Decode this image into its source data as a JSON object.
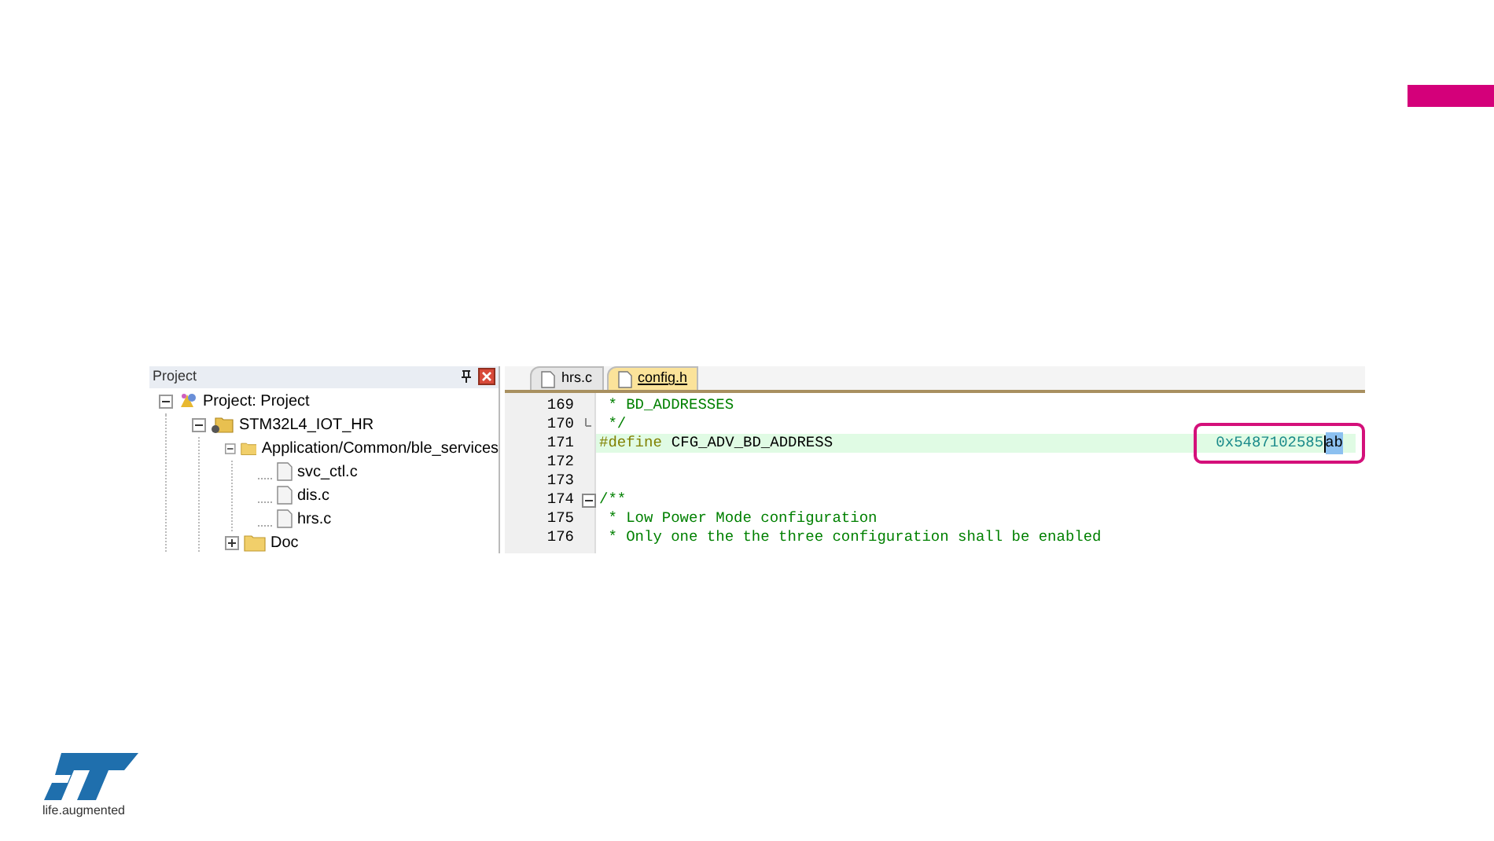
{
  "project_panel": {
    "title": "Project",
    "tree": [
      {
        "label": "Project: Project",
        "kind": "project",
        "expanded": true,
        "children": [
          {
            "label": "STM32L4_IOT_HR",
            "kind": "target",
            "expanded": true,
            "children": [
              {
                "label": "Application/Common/ble_services",
                "kind": "folder",
                "expanded": true,
                "children": [
                  {
                    "label": "svc_ctl.c",
                    "kind": "file"
                  },
                  {
                    "label": "dis.c",
                    "kind": "file"
                  },
                  {
                    "label": "hrs.c",
                    "kind": "file"
                  }
                ]
              },
              {
                "label": "Doc",
                "kind": "folder",
                "expanded": false
              }
            ]
          }
        ]
      }
    ]
  },
  "editor": {
    "tabs": [
      {
        "label": "hrs.c",
        "selected": false
      },
      {
        "label": "config.h",
        "selected": true
      }
    ],
    "lines": [
      {
        "number": "169",
        "kind": "comment",
        "highlighted": false,
        "fold_start": false,
        "fold_end": false,
        "text": " * BD_ADDRESSES"
      },
      {
        "number": "170",
        "kind": "comment",
        "highlighted": false,
        "fold_start": false,
        "fold_end": true,
        "text": " */"
      },
      {
        "number": "171",
        "kind": "define",
        "highlighted": true,
        "fold_start": false,
        "fold_end": false,
        "keyword": "#define",
        "name": "CFG_ADV_BD_ADDRESS",
        "value": "0x5487102585",
        "selected_text": "ab",
        "callout": true
      },
      {
        "number": "172",
        "kind": "blank",
        "highlighted": false,
        "fold_start": false,
        "fold_end": false
      },
      {
        "number": "173",
        "kind": "blank",
        "highlighted": false,
        "fold_start": false,
        "fold_end": false
      },
      {
        "number": "174",
        "kind": "comment",
        "highlighted": false,
        "fold_start": true,
        "fold_end": false,
        "text": "/**"
      },
      {
        "number": "175",
        "kind": "comment",
        "highlighted": false,
        "fold_start": false,
        "fold_end": false,
        "text": " * Low Power Mode configuration"
      },
      {
        "number": "176",
        "kind": "comment",
        "highlighted": false,
        "fold_start": false,
        "fold_end": false,
        "text": " * Only one the the three configuration shall be enabled"
      }
    ]
  },
  "logo": {
    "tagline": "life.augmented"
  }
}
